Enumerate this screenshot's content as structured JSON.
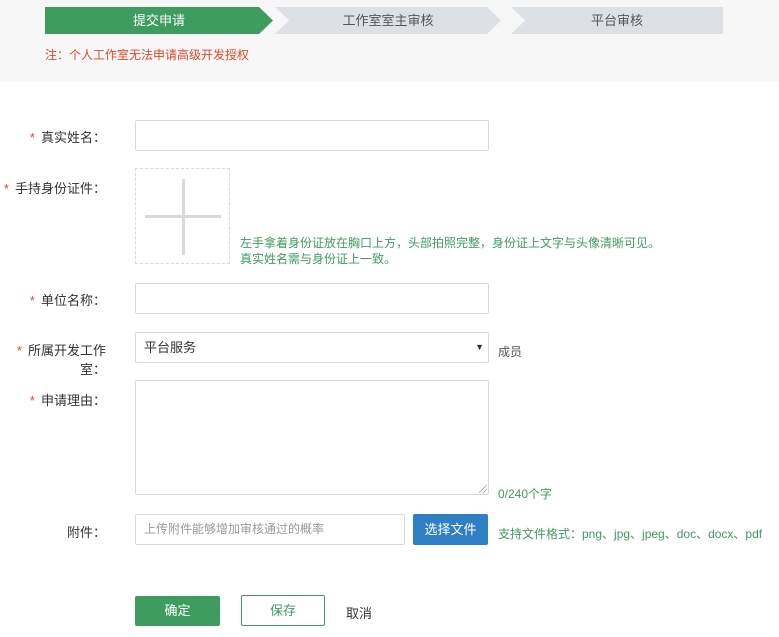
{
  "steps": [
    {
      "label": "提交申请",
      "active": true
    },
    {
      "label": "工作室室主审核",
      "active": false
    },
    {
      "label": "平台审核",
      "active": false
    }
  ],
  "notice": "注：个人工作室无法申请高级开发授权",
  "form": {
    "required_mark": "*",
    "real_name": {
      "label": "真实姓名：",
      "value": ""
    },
    "id_photo": {
      "label": "手持身份证件：",
      "hint_line1": "左手拿着身份证放在胸口上方，头部拍照完整，身份证上文字与头像清晰可见。",
      "hint_line2": "真实姓名需与身份证上一致。"
    },
    "company": {
      "label": "单位名称：",
      "value": ""
    },
    "studio": {
      "label": "所属开发工作室：",
      "selected": "平台服务",
      "role": "成员"
    },
    "reason": {
      "label": "申请理由：",
      "value": "",
      "count": "0/240个字"
    },
    "attachment": {
      "label": "附件：",
      "placeholder": "上传附件能够增加审核通过的概率",
      "button": "选择文件",
      "formats": "支持文件格式：png、jpg、jpeg、doc、docx、pdf"
    }
  },
  "actions": {
    "confirm": "确定",
    "save": "保存",
    "cancel": "取消"
  },
  "colors": {
    "accent": "#3e9c5f",
    "primary_blue": "#2f7fc4",
    "required": "#e0492c",
    "step_inactive": "#dde1e6"
  }
}
